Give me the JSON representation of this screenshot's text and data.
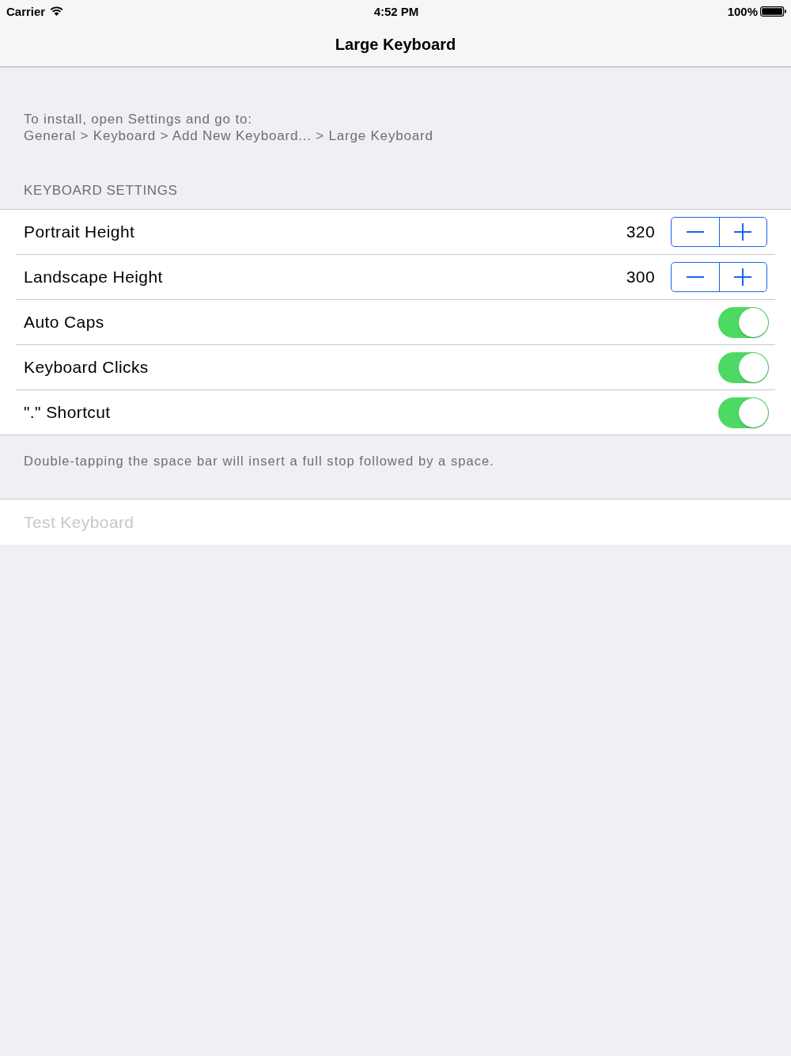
{
  "status_bar": {
    "carrier": "Carrier",
    "time": "4:52 PM",
    "battery": "100%"
  },
  "nav_bar": {
    "title": "Large Keyboard"
  },
  "install_note": "To install, open Settings and go to:\nGeneral > Keyboard > Add New Keyboard... > Large Keyboard",
  "settings_section": {
    "header": "KEYBOARD SETTINGS",
    "rows": [
      {
        "kind": "stepper",
        "label": "Portrait Height",
        "value": "320"
      },
      {
        "kind": "stepper",
        "label": "Landscape Height",
        "value": "300"
      },
      {
        "kind": "toggle",
        "label": "Auto Caps",
        "on": true
      },
      {
        "kind": "toggle",
        "label": "Keyboard Clicks",
        "on": true
      },
      {
        "kind": "toggle",
        "label": "\".\" Shortcut",
        "on": true
      }
    ],
    "footer": "Double-tapping the space bar will insert a full stop followed by a space."
  },
  "test_field": {
    "placeholder": "Test Keyboard"
  }
}
